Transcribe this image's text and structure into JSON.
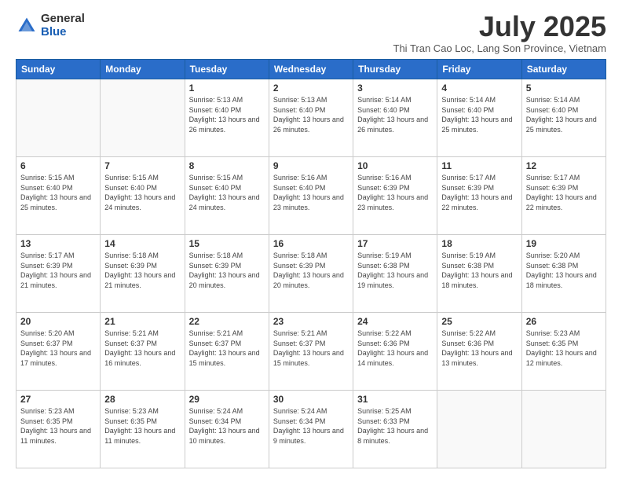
{
  "logo": {
    "general": "General",
    "blue": "Blue"
  },
  "header": {
    "month": "July 2025",
    "subtitle": "Thi Tran Cao Loc, Lang Son Province, Vietnam"
  },
  "weekdays": [
    "Sunday",
    "Monday",
    "Tuesday",
    "Wednesday",
    "Thursday",
    "Friday",
    "Saturday"
  ],
  "weeks": [
    [
      {
        "day": "",
        "info": ""
      },
      {
        "day": "",
        "info": ""
      },
      {
        "day": "1",
        "info": "Sunrise: 5:13 AM\nSunset: 6:40 PM\nDaylight: 13 hours and 26 minutes."
      },
      {
        "day": "2",
        "info": "Sunrise: 5:13 AM\nSunset: 6:40 PM\nDaylight: 13 hours and 26 minutes."
      },
      {
        "day": "3",
        "info": "Sunrise: 5:14 AM\nSunset: 6:40 PM\nDaylight: 13 hours and 26 minutes."
      },
      {
        "day": "4",
        "info": "Sunrise: 5:14 AM\nSunset: 6:40 PM\nDaylight: 13 hours and 25 minutes."
      },
      {
        "day": "5",
        "info": "Sunrise: 5:14 AM\nSunset: 6:40 PM\nDaylight: 13 hours and 25 minutes."
      }
    ],
    [
      {
        "day": "6",
        "info": "Sunrise: 5:15 AM\nSunset: 6:40 PM\nDaylight: 13 hours and 25 minutes."
      },
      {
        "day": "7",
        "info": "Sunrise: 5:15 AM\nSunset: 6:40 PM\nDaylight: 13 hours and 24 minutes."
      },
      {
        "day": "8",
        "info": "Sunrise: 5:15 AM\nSunset: 6:40 PM\nDaylight: 13 hours and 24 minutes."
      },
      {
        "day": "9",
        "info": "Sunrise: 5:16 AM\nSunset: 6:40 PM\nDaylight: 13 hours and 23 minutes."
      },
      {
        "day": "10",
        "info": "Sunrise: 5:16 AM\nSunset: 6:39 PM\nDaylight: 13 hours and 23 minutes."
      },
      {
        "day": "11",
        "info": "Sunrise: 5:17 AM\nSunset: 6:39 PM\nDaylight: 13 hours and 22 minutes."
      },
      {
        "day": "12",
        "info": "Sunrise: 5:17 AM\nSunset: 6:39 PM\nDaylight: 13 hours and 22 minutes."
      }
    ],
    [
      {
        "day": "13",
        "info": "Sunrise: 5:17 AM\nSunset: 6:39 PM\nDaylight: 13 hours and 21 minutes."
      },
      {
        "day": "14",
        "info": "Sunrise: 5:18 AM\nSunset: 6:39 PM\nDaylight: 13 hours and 21 minutes."
      },
      {
        "day": "15",
        "info": "Sunrise: 5:18 AM\nSunset: 6:39 PM\nDaylight: 13 hours and 20 minutes."
      },
      {
        "day": "16",
        "info": "Sunrise: 5:18 AM\nSunset: 6:39 PM\nDaylight: 13 hours and 20 minutes."
      },
      {
        "day": "17",
        "info": "Sunrise: 5:19 AM\nSunset: 6:38 PM\nDaylight: 13 hours and 19 minutes."
      },
      {
        "day": "18",
        "info": "Sunrise: 5:19 AM\nSunset: 6:38 PM\nDaylight: 13 hours and 18 minutes."
      },
      {
        "day": "19",
        "info": "Sunrise: 5:20 AM\nSunset: 6:38 PM\nDaylight: 13 hours and 18 minutes."
      }
    ],
    [
      {
        "day": "20",
        "info": "Sunrise: 5:20 AM\nSunset: 6:37 PM\nDaylight: 13 hours and 17 minutes."
      },
      {
        "day": "21",
        "info": "Sunrise: 5:21 AM\nSunset: 6:37 PM\nDaylight: 13 hours and 16 minutes."
      },
      {
        "day": "22",
        "info": "Sunrise: 5:21 AM\nSunset: 6:37 PM\nDaylight: 13 hours and 15 minutes."
      },
      {
        "day": "23",
        "info": "Sunrise: 5:21 AM\nSunset: 6:37 PM\nDaylight: 13 hours and 15 minutes."
      },
      {
        "day": "24",
        "info": "Sunrise: 5:22 AM\nSunset: 6:36 PM\nDaylight: 13 hours and 14 minutes."
      },
      {
        "day": "25",
        "info": "Sunrise: 5:22 AM\nSunset: 6:36 PM\nDaylight: 13 hours and 13 minutes."
      },
      {
        "day": "26",
        "info": "Sunrise: 5:23 AM\nSunset: 6:35 PM\nDaylight: 13 hours and 12 minutes."
      }
    ],
    [
      {
        "day": "27",
        "info": "Sunrise: 5:23 AM\nSunset: 6:35 PM\nDaylight: 13 hours and 11 minutes."
      },
      {
        "day": "28",
        "info": "Sunrise: 5:23 AM\nSunset: 6:35 PM\nDaylight: 13 hours and 11 minutes."
      },
      {
        "day": "29",
        "info": "Sunrise: 5:24 AM\nSunset: 6:34 PM\nDaylight: 13 hours and 10 minutes."
      },
      {
        "day": "30",
        "info": "Sunrise: 5:24 AM\nSunset: 6:34 PM\nDaylight: 13 hours and 9 minutes."
      },
      {
        "day": "31",
        "info": "Sunrise: 5:25 AM\nSunset: 6:33 PM\nDaylight: 13 hours and 8 minutes."
      },
      {
        "day": "",
        "info": ""
      },
      {
        "day": "",
        "info": ""
      }
    ]
  ]
}
